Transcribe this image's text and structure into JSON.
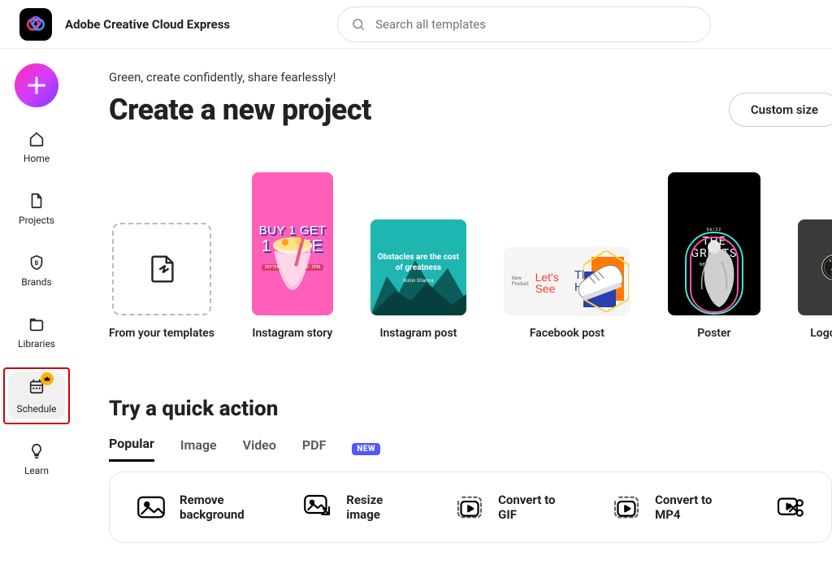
{
  "header": {
    "app_title": "Adobe Creative Cloud Express",
    "search_placeholder": "Search all templates"
  },
  "sidebar": {
    "items": [
      {
        "label": "Home"
      },
      {
        "label": "Projects"
      },
      {
        "label": "Brands"
      },
      {
        "label": "Libraries"
      },
      {
        "label": "Schedule"
      },
      {
        "label": "Learn"
      }
    ]
  },
  "main": {
    "tagline": "Green, create confidently, share fearlessly!",
    "page_title": "Create a new project",
    "custom_size_label": "Custom size"
  },
  "templates": [
    {
      "label": "From your templates"
    },
    {
      "label": "Instagram story",
      "text1": "BUY 1 GET",
      "text2": "1 FREE"
    },
    {
      "label": "Instagram post",
      "text": "Obstacles are the cost of greatness",
      "author": "Robin Sharma"
    },
    {
      "label": "Facebook post",
      "sub": "New Product",
      "text1": "Let's See",
      "text2": "The HYPE"
    },
    {
      "label": "Poster",
      "pretitle": "06/22",
      "title1": "THE",
      "title2": "GREATS",
      "sub": "NEW EXHIBIT"
    },
    {
      "label": "Logo"
    }
  ],
  "quick_actions": {
    "section_title": "Try a quick action",
    "tabs": [
      {
        "label": "Popular"
      },
      {
        "label": "Image"
      },
      {
        "label": "Video"
      },
      {
        "label": "PDF"
      }
    ],
    "new_badge": "NEW",
    "items": [
      {
        "label": "Remove background"
      },
      {
        "label": "Resize image"
      },
      {
        "label": "Convert to GIF"
      },
      {
        "label": "Convert to MP4"
      }
    ]
  }
}
